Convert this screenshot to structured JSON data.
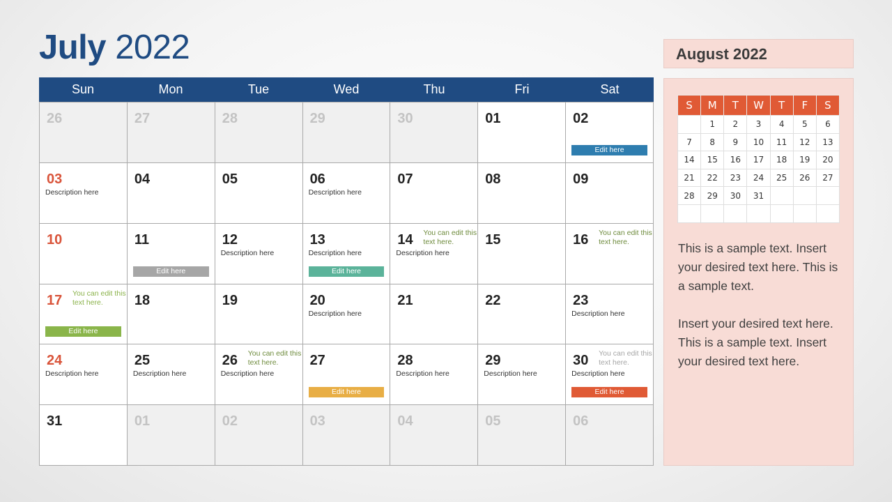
{
  "title": {
    "month": "July",
    "year": "2022"
  },
  "weekdays": [
    "Sun",
    "Mon",
    "Tue",
    "Wed",
    "Thu",
    "Fri",
    "Sat"
  ],
  "colors": {
    "header_blue": "#1F4B82",
    "weekend_red": "#D9543A",
    "note_green": "#6E8B3D",
    "mini_header_orange": "#E05A35",
    "panel_pink": "#F8DCD6"
  },
  "cells": [
    {
      "day": "26",
      "other": true
    },
    {
      "day": "27",
      "other": true
    },
    {
      "day": "28",
      "other": true
    },
    {
      "day": "29",
      "other": true
    },
    {
      "day": "30",
      "other": true
    },
    {
      "day": "01"
    },
    {
      "day": "02",
      "edit": "Edit here",
      "edit_color": "#2E7DAF"
    },
    {
      "day": "03",
      "sunday": true,
      "desc": "Description here"
    },
    {
      "day": "04"
    },
    {
      "day": "05"
    },
    {
      "day": "06",
      "desc": "Description here"
    },
    {
      "day": "07"
    },
    {
      "day": "08"
    },
    {
      "day": "09"
    },
    {
      "day": "10",
      "sunday": true
    },
    {
      "day": "11",
      "edit": "Edit here",
      "edit_color": "#A6A6A6"
    },
    {
      "day": "12",
      "desc": "Description here"
    },
    {
      "day": "13",
      "desc": "Description here",
      "edit": "Edit here",
      "edit_color": "#5BB39A"
    },
    {
      "day": "14",
      "desc": "Description here",
      "note": "You can edit this text here."
    },
    {
      "day": "15"
    },
    {
      "day": "16",
      "note": "You can edit this text here."
    },
    {
      "day": "17",
      "sunday": true,
      "note": "You can edit this text here.",
      "note_color": "#8AB24A",
      "edit": "Edit here",
      "edit_color": "#8AB54A"
    },
    {
      "day": "18"
    },
    {
      "day": "19"
    },
    {
      "day": "20",
      "desc": "Description here"
    },
    {
      "day": "21"
    },
    {
      "day": "22"
    },
    {
      "day": "23",
      "desc": "Description here"
    },
    {
      "day": "24",
      "sunday": true,
      "desc": "Description here"
    },
    {
      "day": "25",
      "desc": "Description here"
    },
    {
      "day": "26",
      "desc": "Description here",
      "note": "You can edit this text here."
    },
    {
      "day": "27",
      "edit": "Edit here",
      "edit_color": "#E8AE45"
    },
    {
      "day": "28",
      "desc": "Description here"
    },
    {
      "day": "29",
      "desc": "Description here"
    },
    {
      "day": "30",
      "desc": "Description here",
      "note": "You can edit this text here.",
      "note_grey": true,
      "edit": "Edit here",
      "edit_color": "#E05A35"
    },
    {
      "day": "31"
    },
    {
      "day": "01",
      "other": true
    },
    {
      "day": "02",
      "other": true
    },
    {
      "day": "03",
      "other": true
    },
    {
      "day": "04",
      "other": true
    },
    {
      "day": "05",
      "other": true
    },
    {
      "day": "06",
      "other": true
    }
  ],
  "side": {
    "title": "August 2022",
    "mini_weekdays": [
      "S",
      "M",
      "T",
      "W",
      "T",
      "F",
      "S"
    ],
    "mini_weeks": [
      [
        "",
        "1",
        "2",
        "3",
        "4",
        "5",
        "6"
      ],
      [
        "7",
        "8",
        "9",
        "10",
        "11",
        "12",
        "13"
      ],
      [
        "14",
        "15",
        "16",
        "17",
        "18",
        "19",
        "20"
      ],
      [
        "21",
        "22",
        "23",
        "24",
        "25",
        "26",
        "27"
      ],
      [
        "28",
        "29",
        "30",
        "31",
        "",
        "",
        ""
      ],
      [
        "",
        "",
        "",
        "",
        "",
        "",
        ""
      ]
    ],
    "paragraphs": [
      "This is a sample text. Insert your desired text here. This is a sample text.",
      "Insert your desired text here. This is a sample text. Insert your desired text here."
    ]
  }
}
